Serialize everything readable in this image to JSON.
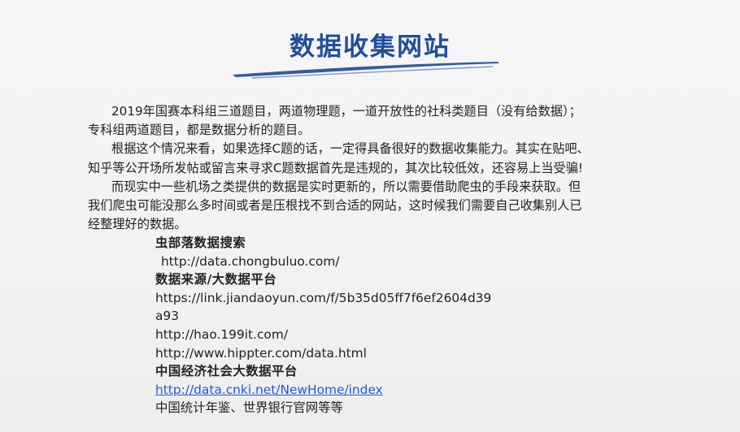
{
  "title": "数据收集网站",
  "intro": {
    "p1_line1": "2019年国赛本科组三道题目，两道物理题，一道开放性的社科类题目（没有给数据）；",
    "p1_line2": "专科组两道题目，都是数据分析的题目。",
    "p2_line1": "根据这个情况来看，如果选择C题的话，一定得具备很好的数据收集能力。其实在贴吧、",
    "p2_line2": "知乎等公开场所发帖或留言来寻求C题数据首先是违规的，其次比较低效，还容易上当受骗!",
    "p3_line1": "而现实中一些机场之类提供的数据是实时更新的，所以需要借助爬虫的手段来获取。但",
    "p3_line2": "我们爬虫可能没那么多时间或者是压根找不到合适的网站，这时候我们需要自己收集别人已",
    "p3_line3": "经整理好的数据。"
  },
  "links": {
    "heading1": "虫部落数据搜索",
    "url1": "http://data.chongbuluo.com/",
    "heading2": "数据来源/大数据平台",
    "url2_line1": "https://link.jiandaoyun.com/f/5b35d05ff7f6ef2604d39",
    "url2_line2": "a93",
    "url3": "http://hao.199it.com/",
    "url4": "http://www.hippter.com/data.html",
    "heading3": "中国经济社会大数据平台",
    "url5": "http://data.cnki.net/NewHome/index",
    "note": "中国统计年鉴、世界银行官网等等"
  },
  "colors": {
    "title": "#1f4e9c",
    "link": "#1d5bd8",
    "text": "#222222",
    "swoosh": "#1f4e9c"
  }
}
